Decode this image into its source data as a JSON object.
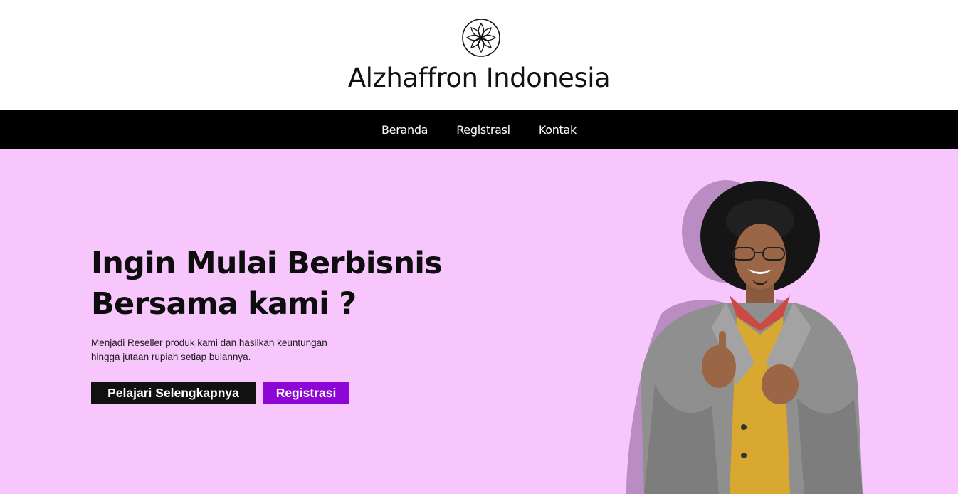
{
  "brand": {
    "title": "Alzhaffron Indonesia",
    "logo_icon": "mandala-flower-icon"
  },
  "nav": {
    "items": [
      {
        "label": "Beranda"
      },
      {
        "label": "Registrasi"
      },
      {
        "label": "Kontak"
      }
    ]
  },
  "hero": {
    "title_line1": "Ingin Mulai Berbisnis",
    "title_line2": "Bersama kami ?",
    "description_line1": "Menjadi Reseller produk kami dan hasilkan keuntungan",
    "description_line2": "hingga jutaan rupiah setiap bulannya.",
    "primary_button": "Pelajari Selengkapnya",
    "secondary_button": "Registrasi",
    "image_icon": "smiling-man-in-hat-photo"
  },
  "colors": {
    "hero_background": "#f7c6fd",
    "nav_background": "#000000",
    "primary_button": "#111111",
    "secondary_button": "#8e06d6"
  }
}
